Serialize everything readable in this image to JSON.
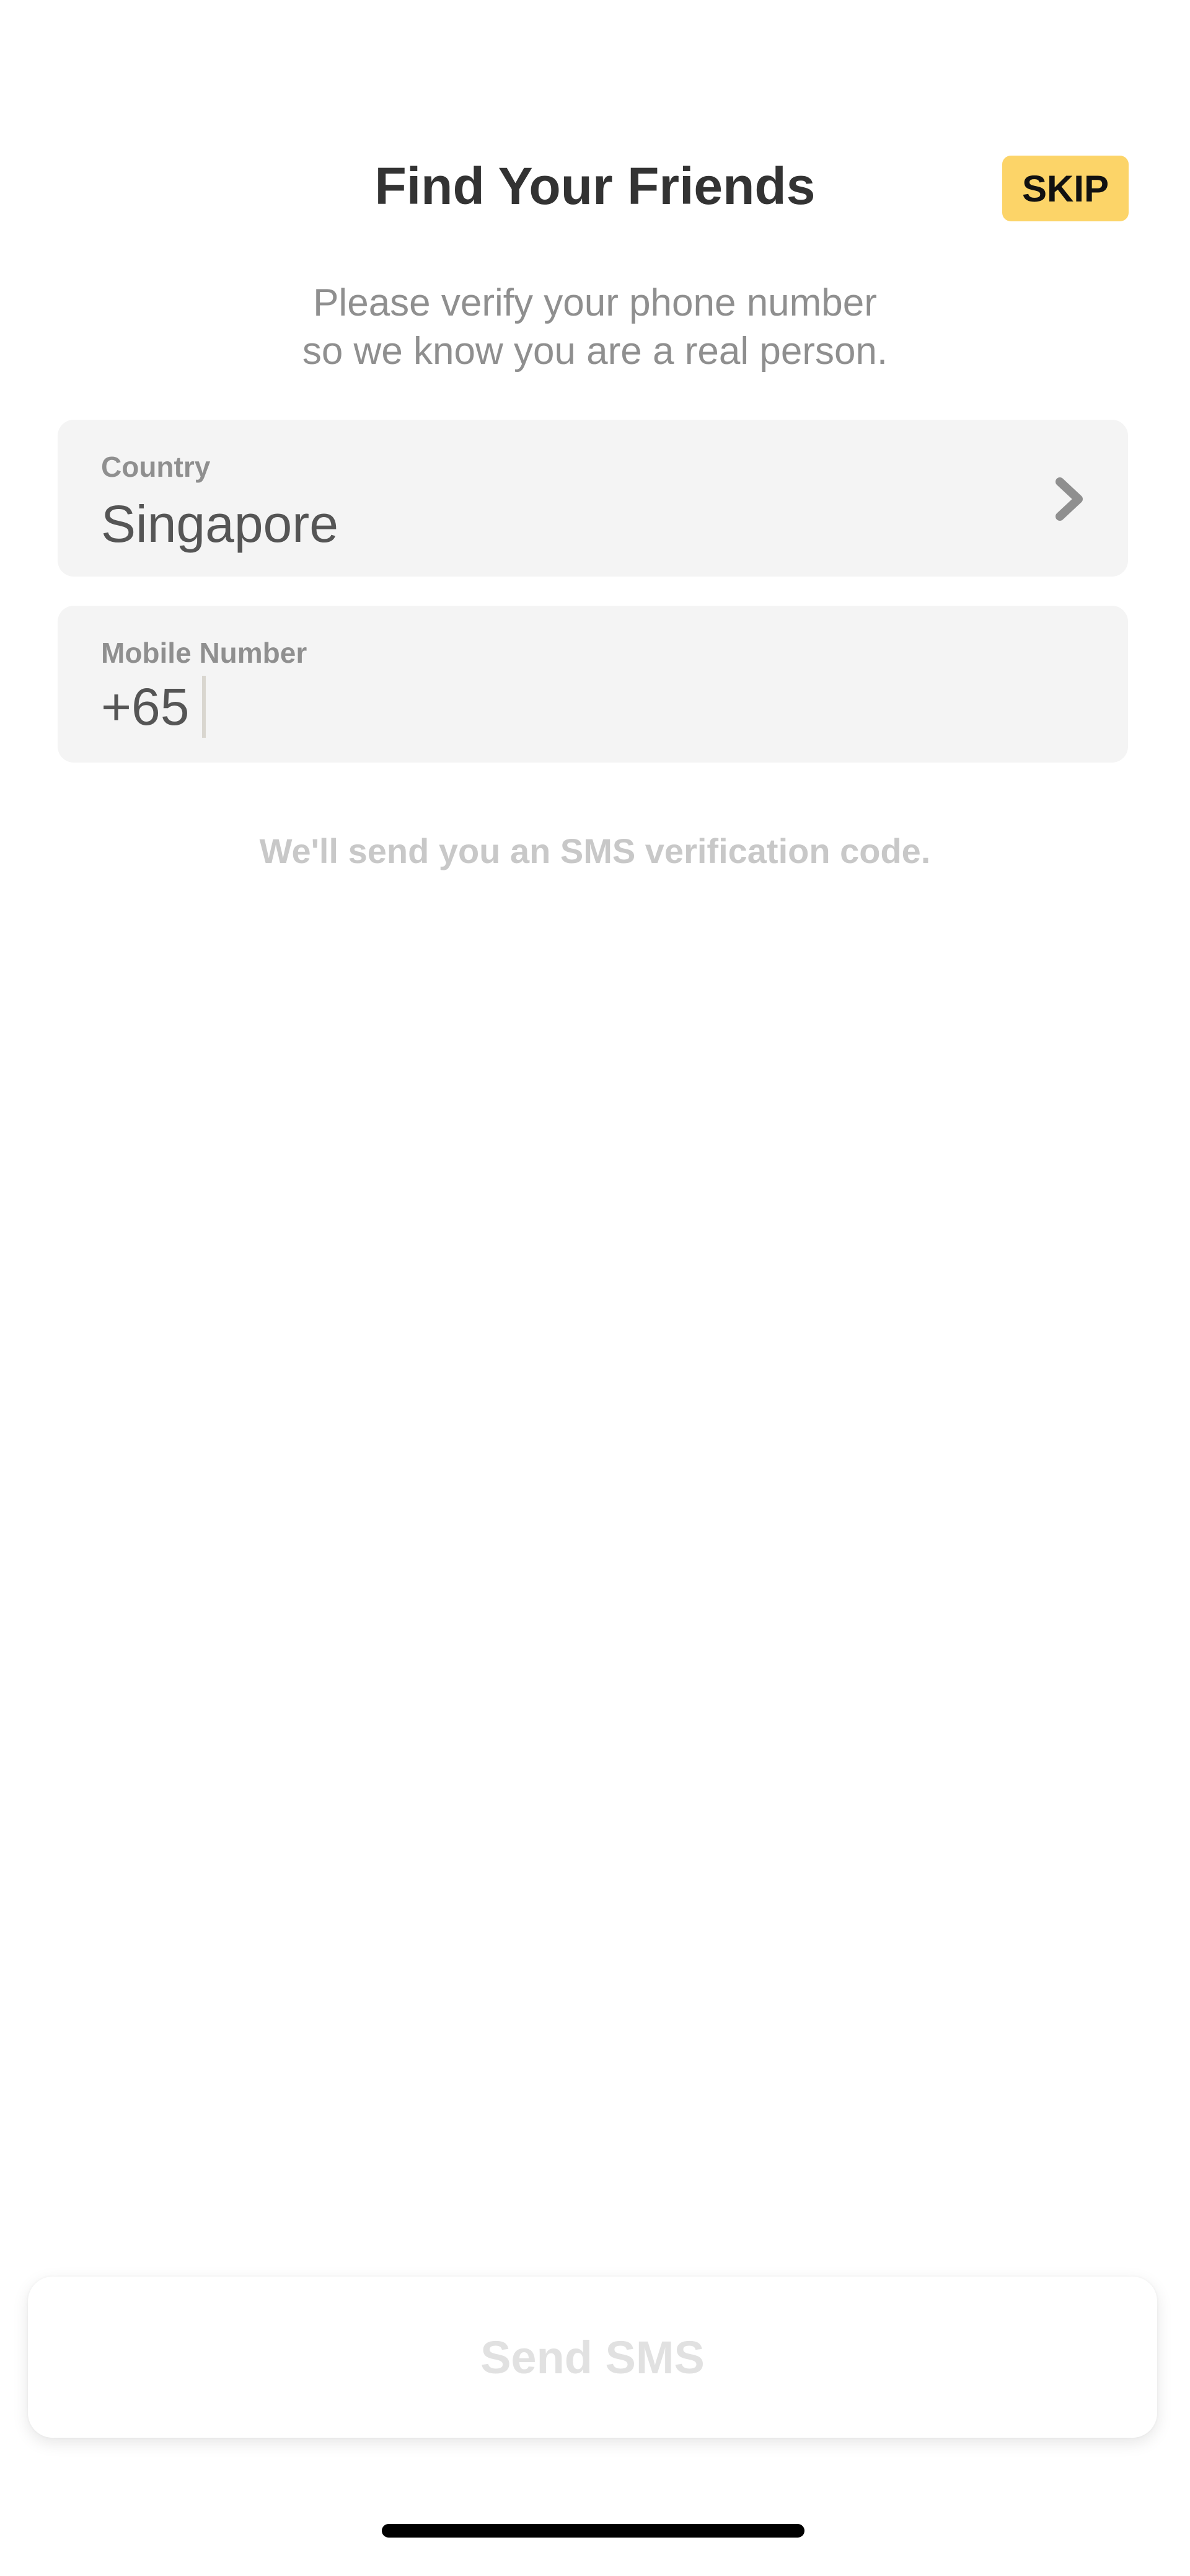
{
  "header": {
    "title": "Find Your Friends",
    "skip_label": "SKIP"
  },
  "subtitle": {
    "line1": "Please verify your phone number",
    "line2": "so we know you are a real person."
  },
  "country_field": {
    "label": "Country",
    "value": "Singapore",
    "icon": "chevron-right-icon"
  },
  "mobile_field": {
    "label": "Mobile Number",
    "dial_code": "+65",
    "value": ""
  },
  "helper_text": "We'll send you an SMS verification code.",
  "send_button": {
    "label": "Send SMS",
    "enabled": false
  },
  "colors": {
    "skip_background": "#fcd468",
    "field_background": "#f4f4f4",
    "title_text": "#333333",
    "secondary_text": "#8f8f8f",
    "disabled_text": "#e1e1e1"
  }
}
